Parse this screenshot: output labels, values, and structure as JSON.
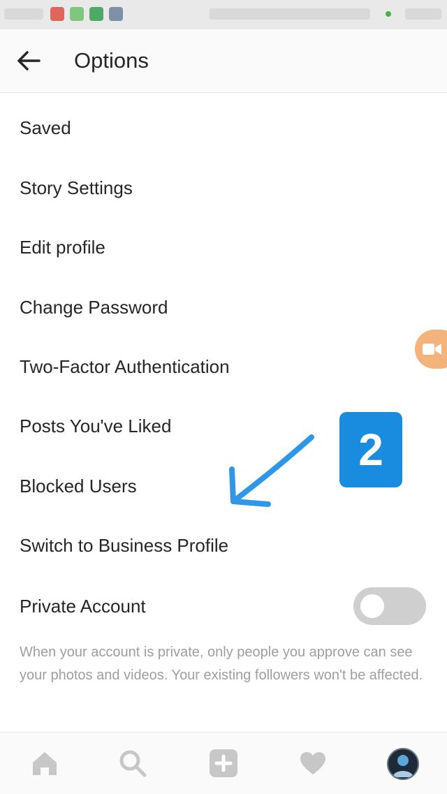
{
  "header": {
    "title": "Options",
    "back_icon": "arrow-left-icon"
  },
  "menu": {
    "items": [
      {
        "label": "Saved"
      },
      {
        "label": "Story Settings"
      },
      {
        "label": "Edit profile"
      },
      {
        "label": "Change Password"
      },
      {
        "label": "Two-Factor Authentication"
      },
      {
        "label": "Posts You've Liked"
      },
      {
        "label": "Blocked Users"
      },
      {
        "label": "Switch to Business Profile"
      }
    ]
  },
  "private_account": {
    "label": "Private Account",
    "enabled": false,
    "description": "When your account is private, only people you approve can see your photos and videos. Your existing followers won't be affected."
  },
  "annotation": {
    "step_number": "2",
    "color": "#1a8ce0"
  },
  "bottom_nav": {
    "items": [
      {
        "icon": "home-icon"
      },
      {
        "icon": "search-icon"
      },
      {
        "icon": "add-post-icon"
      },
      {
        "icon": "heart-icon"
      },
      {
        "icon": "profile-avatar-icon"
      }
    ]
  },
  "colors": {
    "text_primary": "#262626",
    "text_secondary": "#9e9e9e",
    "nav_icon": "#c7c7c7",
    "toggle_off": "#cfcfcf",
    "floating_button": "#f3b37a"
  }
}
